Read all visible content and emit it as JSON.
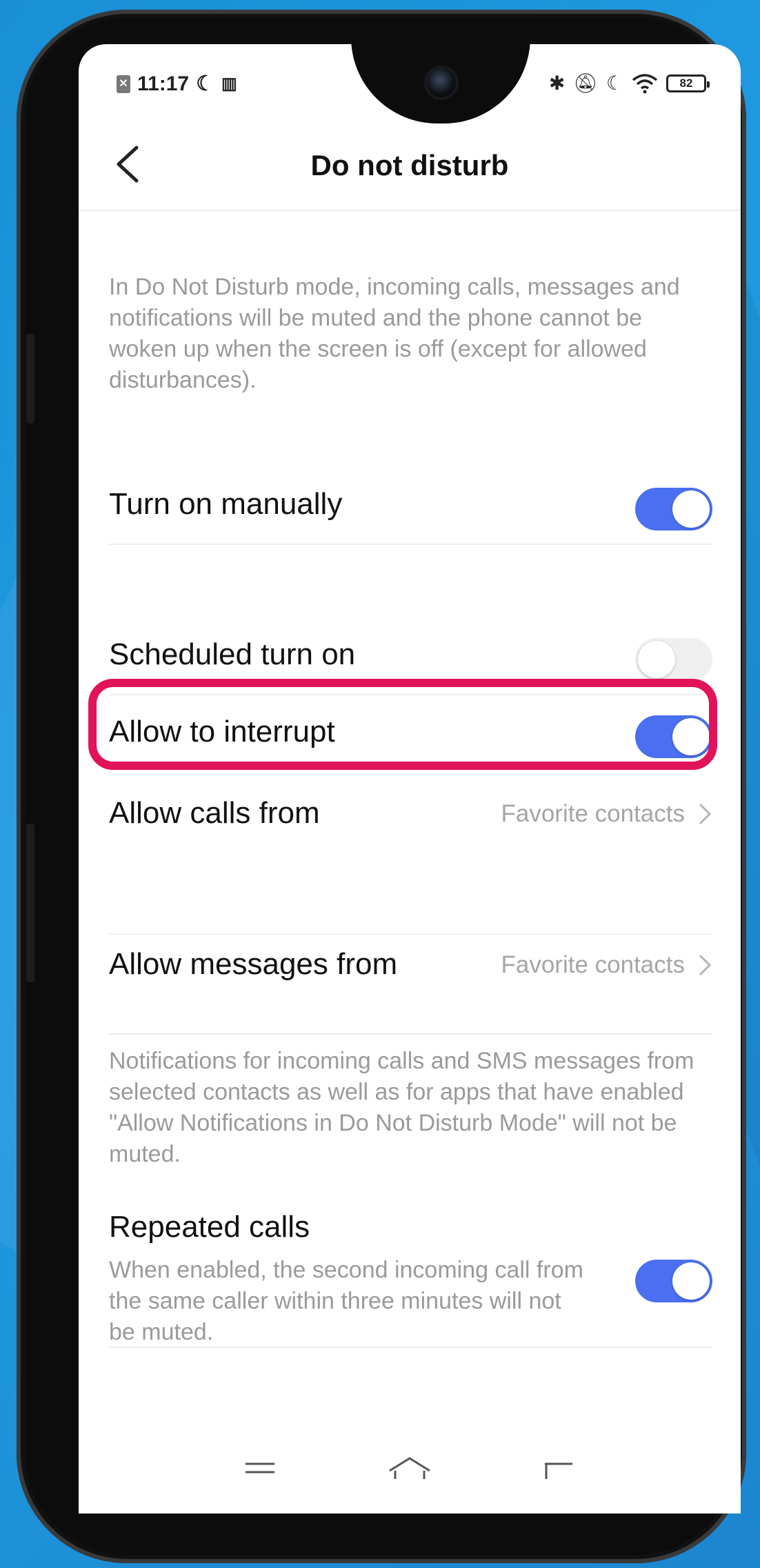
{
  "status_bar": {
    "time": "11:17",
    "battery": "82"
  },
  "header": {
    "title": "Do not disturb"
  },
  "intro_text": "In Do Not Disturb mode, incoming calls, messages and notifications will be muted and the phone cannot be woken up when the screen is off (except for allowed disturbances).",
  "settings": {
    "turn_on_manually": {
      "label": "Turn on manually",
      "enabled": true
    },
    "scheduled_turn_on": {
      "label": "Scheduled turn on",
      "enabled": false
    },
    "allow_to_interrupt": {
      "label": "Allow to interrupt",
      "enabled": true
    },
    "allow_calls_from": {
      "label": "Allow calls from",
      "value": "Favorite contacts"
    },
    "allow_messages_from": {
      "label": "Allow messages from",
      "value": "Favorite contacts"
    },
    "repeated_calls": {
      "label": "Repeated calls",
      "description": "When enabled, the second incoming call from the same caller within three minutes will not be muted.",
      "enabled": true
    }
  },
  "notifications_note": "Notifications for incoming calls and SMS messages from selected contacts as well as for apps that have enabled \"Allow Notifications in Do Not Disturb Mode\" will not be muted.",
  "colors": {
    "toggle_on": "#4a6ff0",
    "highlight": "#e2135a"
  }
}
